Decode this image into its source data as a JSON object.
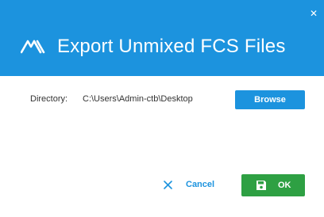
{
  "header": {
    "title": "Export Unmixed FCS Files",
    "logo_icon": "cytek-logo-icon",
    "close_icon": "close-icon"
  },
  "directory": {
    "label": "Directory:",
    "path": "C:\\Users\\Admin-ctb\\Desktop",
    "browse_label": "Browse"
  },
  "footer": {
    "cancel_label": "Cancel",
    "cancel_icon": "close-x-icon",
    "ok_label": "OK",
    "ok_icon": "save-disk-icon"
  },
  "colors": {
    "header_bg": "#1c93de",
    "accent": "#1c93de",
    "ok_bg": "#2ea043"
  }
}
